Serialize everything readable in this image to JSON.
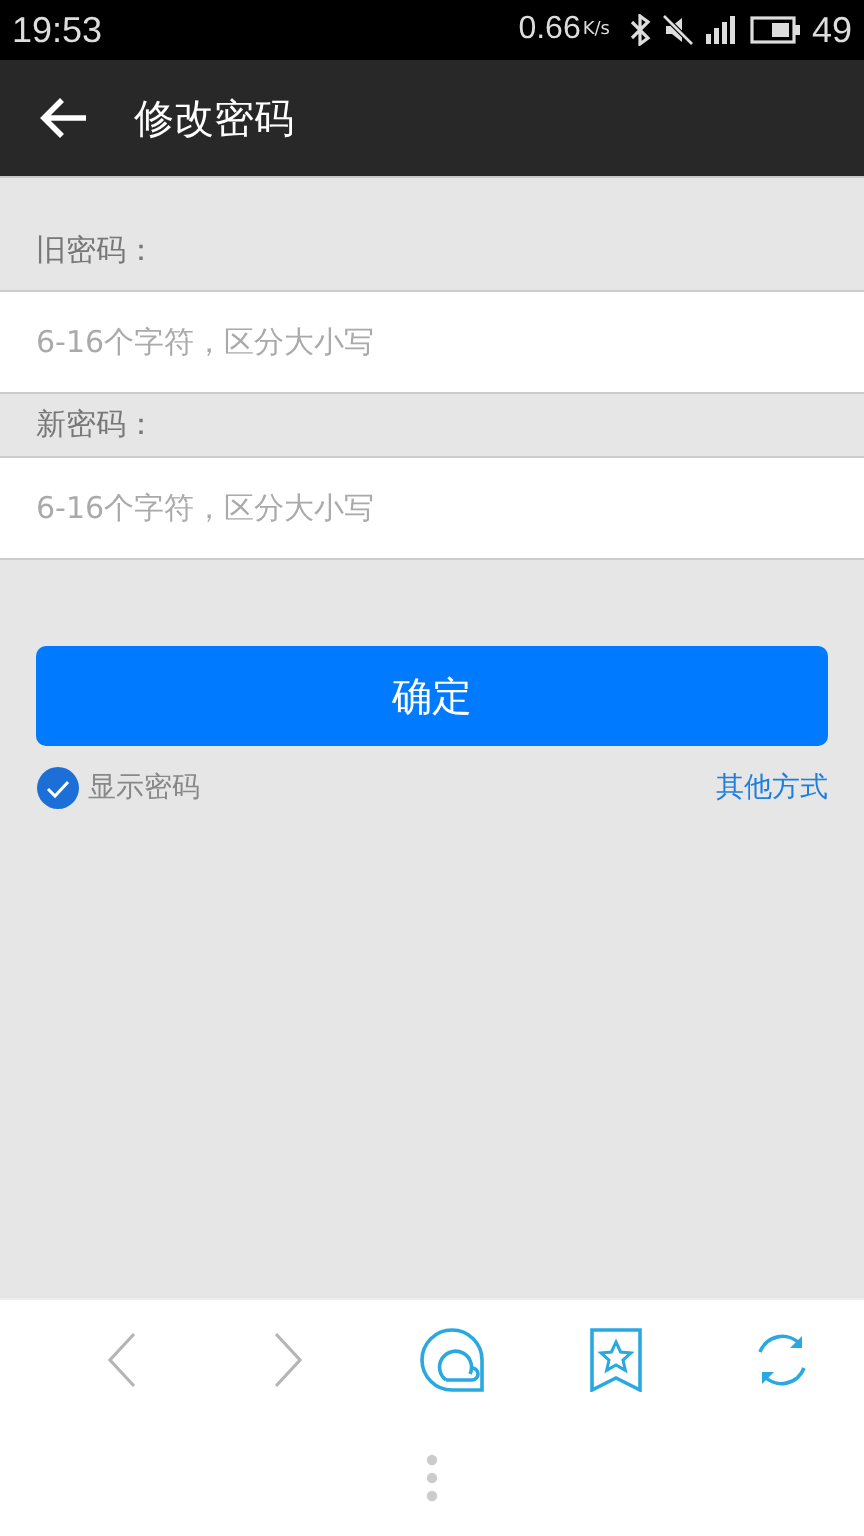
{
  "status_bar": {
    "time": "19:53",
    "speed": "0.66",
    "speed_unit": "K/s",
    "battery_text": "49"
  },
  "app_bar": {
    "title": "修改密码"
  },
  "fields": [
    {
      "label": "旧密码：",
      "placeholder": "6-16个字符，区分大小写"
    },
    {
      "label": "新密码：",
      "placeholder": "6-16个字符，区分大小写"
    }
  ],
  "submit": {
    "label": "确定"
  },
  "show_password": {
    "label": "显示密码",
    "checked": true
  },
  "other_link": {
    "label": "其他方式"
  },
  "toolbar": [
    {
      "kind": "back",
      "disabled": true
    },
    {
      "kind": "forward",
      "disabled": true
    },
    {
      "kind": "cloud",
      "disabled": false
    },
    {
      "kind": "bookmark",
      "disabled": false
    },
    {
      "kind": "refresh",
      "disabled": false
    }
  ]
}
